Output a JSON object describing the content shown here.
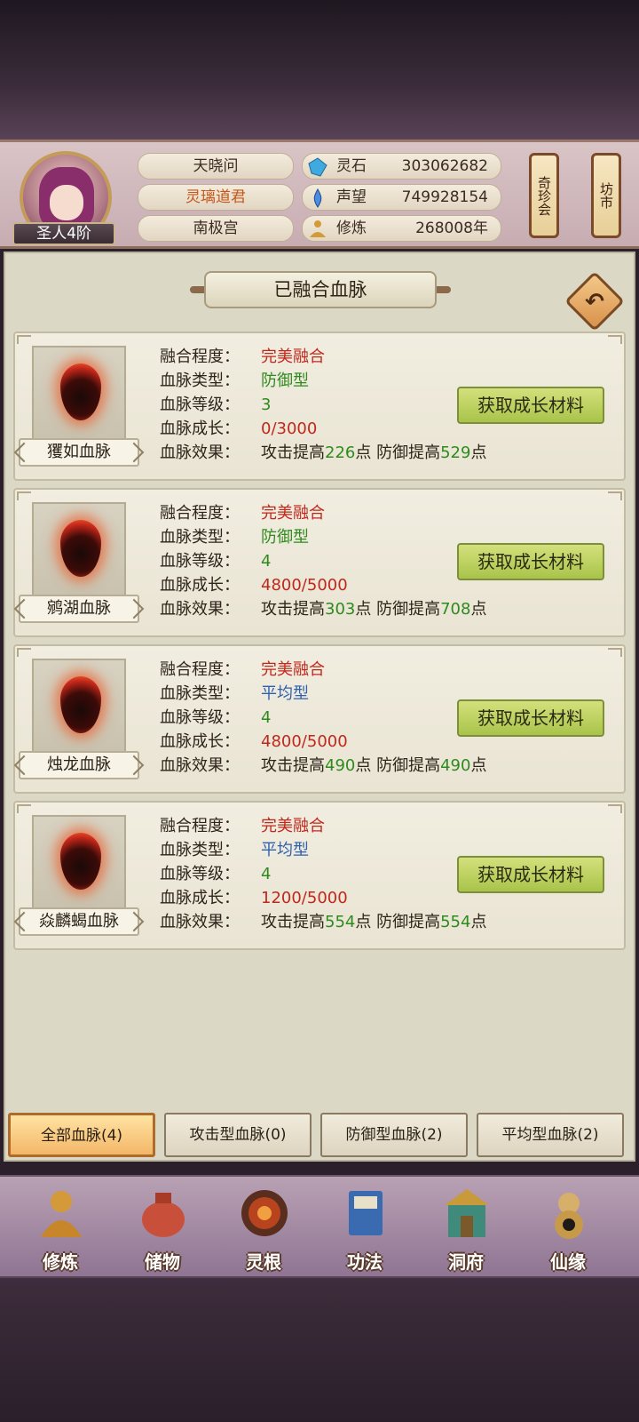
{
  "header": {
    "player_name": "天晓问",
    "title": "灵璃道君",
    "location": "南极宫",
    "rank": "圣人4阶",
    "stats": [
      {
        "label": "灵石",
        "value": "303062682",
        "icon": "spirit-stone-icon",
        "color": "#3fa9e0"
      },
      {
        "label": "声望",
        "value": "749928154",
        "icon": "reputation-icon",
        "color": "#4a8de0"
      },
      {
        "label": "修炼",
        "value": "268008年",
        "icon": "meditation-icon",
        "color": "#d49a3a"
      }
    ],
    "buttons": [
      "奇珍会",
      "坊市"
    ]
  },
  "panel": {
    "title": "已融合血脉"
  },
  "field_labels": {
    "fusion": "融合程度：",
    "type": "血脉类型：",
    "level": "血脉等级：",
    "growth": "血脉成长：",
    "effect": "血脉效果："
  },
  "effect_text": {
    "atk_prefix": "攻击提高",
    "def_prefix": "防御提高",
    "unit": "点"
  },
  "grow_button_label": "获取成长材料",
  "bloodlines": [
    {
      "name": "玃如血脉",
      "fusion": "完美融合",
      "type": "防御型",
      "type_color": "green",
      "level": "3",
      "growth": "0/3000",
      "atk": "226",
      "def": "529"
    },
    {
      "name": "鹓湖血脉",
      "fusion": "完美融合",
      "type": "防御型",
      "type_color": "green",
      "level": "4",
      "growth": "4800/5000",
      "atk": "303",
      "def": "708"
    },
    {
      "name": "烛龙血脉",
      "fusion": "完美融合",
      "type": "平均型",
      "type_color": "blue",
      "level": "4",
      "growth": "4800/5000",
      "atk": "490",
      "def": "490"
    },
    {
      "name": "焱麟蝎血脉",
      "fusion": "完美融合",
      "type": "平均型",
      "type_color": "blue",
      "level": "4",
      "growth": "1200/5000",
      "atk": "554",
      "def": "554"
    }
  ],
  "tabs": [
    {
      "label": "全部血脉(4)",
      "active": true
    },
    {
      "label": "攻击型血脉(0)",
      "active": false
    },
    {
      "label": "防御型血脉(2)",
      "active": false
    },
    {
      "label": "平均型血脉(2)",
      "active": false
    }
  ],
  "nav": [
    {
      "label": "修炼",
      "icon": "cultivation-icon",
      "color": "#d49a3a"
    },
    {
      "label": "储物",
      "icon": "storage-bag-icon",
      "color": "#c8503a"
    },
    {
      "label": "灵根",
      "icon": "spirit-root-icon",
      "color": "#b8441f"
    },
    {
      "label": "功法",
      "icon": "technique-book-icon",
      "color": "#3a6ab0"
    },
    {
      "label": "洞府",
      "icon": "cave-dwelling-icon",
      "color": "#3f8a7a"
    },
    {
      "label": "仙缘",
      "icon": "immortal-fate-icon",
      "color": "#d6b06a"
    }
  ]
}
